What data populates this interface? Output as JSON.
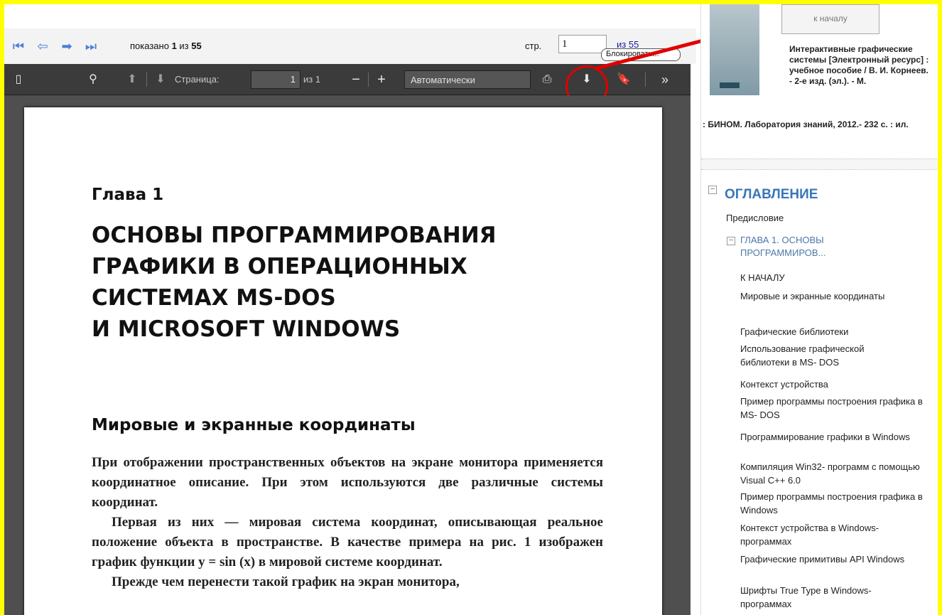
{
  "viewer_nav": {
    "shown_prefix": "показано",
    "shown_current": "1",
    "shown_mid": "из",
    "shown_total": "55",
    "page_label": "стр.",
    "page_value": "1",
    "of_total": "из 55",
    "tooltip": "Блокировать..."
  },
  "pdf_toolbar": {
    "page_label": "Страница:",
    "page_value": "1",
    "page_of": "из 1",
    "zoom_value": "Автоматически"
  },
  "pdf_page": {
    "chapter": "Глава 1",
    "chapter_title": "ОСНОВЫ ПРОГРАММИРОВАНИЯ\nГРАФИКИ В ОПЕРАЦИОННЫХ\nСИСТЕМАХ MS-DOS\nИ MICROSOFT WINDOWS",
    "section": "Мировые и экранные координаты",
    "para1": "При отображении пространственных объектов на экране монитора применяется координатное описание. При этом используются две различные системы координат.",
    "para2": "Первая из них — мировая система координат, описывающая реальное положение объекта в пространстве. В качестве примера на рис. 1 изображен график функции y = sin (x) в мировой системе координат.",
    "para3": "Прежде чем перенести такой график на экран монитора,"
  },
  "book": {
    "start_button": "к началу",
    "desc_bold": "Интерактивные графические системы [Электронный ресурс] : учебное пособие / В. И. Корнеев. - 2-е изд. (эл.). - М.",
    "desc_tail": ": БИНОМ. Лаборатория знаний, 2012.- 232 с. : ил."
  },
  "toc": {
    "title": "ОГЛАВЛЕНИЕ",
    "preface": "Предисловие",
    "chapter": "ГЛАВА 1. ОСНОВЫ ПРОГРАММИРОВ...",
    "items": [
      "К НАЧАЛУ",
      "Мировые и экранные координаты",
      "Графические библиотеки",
      "Использование графической библиотеки в MS- DOS",
      "Контекст устройства",
      "Пример программы построения графика в MS- DOS",
      "Программирование графики в Windows",
      "Компиляция Win32- программ с помощью Visual C++ 6.0",
      "Пример программы построения графика в Windows",
      "Контекст устройства в Windows-программах",
      "Графические примитивы API Windows",
      "Шрифты True Type в Windows-программах"
    ]
  },
  "colors": {
    "frame": "#ffff00",
    "annotation": "#e00000",
    "toc_accent": "#3a76b9"
  }
}
